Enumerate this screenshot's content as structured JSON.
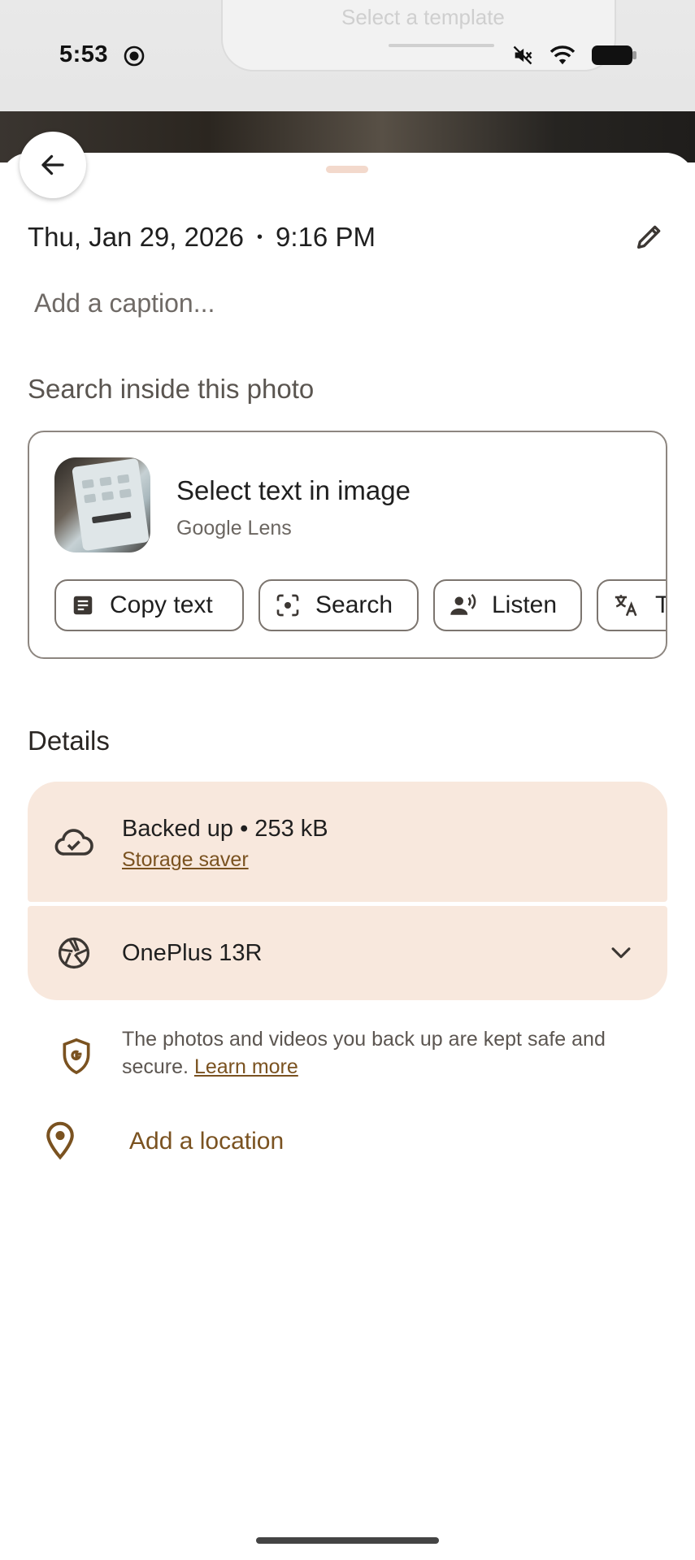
{
  "status_bar": {
    "time": "5:53",
    "icons": [
      "screen-record-icon",
      "mute-icon",
      "wifi-icon",
      "battery-icon"
    ]
  },
  "background_photo": {
    "ghost_text": "Select a template"
  },
  "sheet": {
    "date": "Thu, Jan 29, 2026",
    "separator": "•",
    "time": "9:16 PM",
    "caption_placeholder": "Add a caption..."
  },
  "search_section": {
    "title": "Search inside this photo",
    "lens_title": "Select text in image",
    "lens_subtitle": "Google Lens",
    "chips": [
      {
        "label": "Copy text",
        "icon": "document-icon"
      },
      {
        "label": "Search",
        "icon": "lens-search-icon"
      },
      {
        "label": "Listen",
        "icon": "listen-icon"
      },
      {
        "label": "T",
        "icon": "translate-icon"
      }
    ]
  },
  "details_section": {
    "title": "Details",
    "backup_title": "Backed up • 253 kB",
    "backup_link": "Storage saver",
    "device_name": "OnePlus 13R",
    "secure_text": "The photos and videos you back up are kept safe and secure.",
    "secure_link": "Learn more",
    "location_label": "Add a location"
  },
  "colors": {
    "accent": "#7a5220",
    "card_background": "#f8e8dd",
    "drag_handle": "#f3d9cc"
  }
}
